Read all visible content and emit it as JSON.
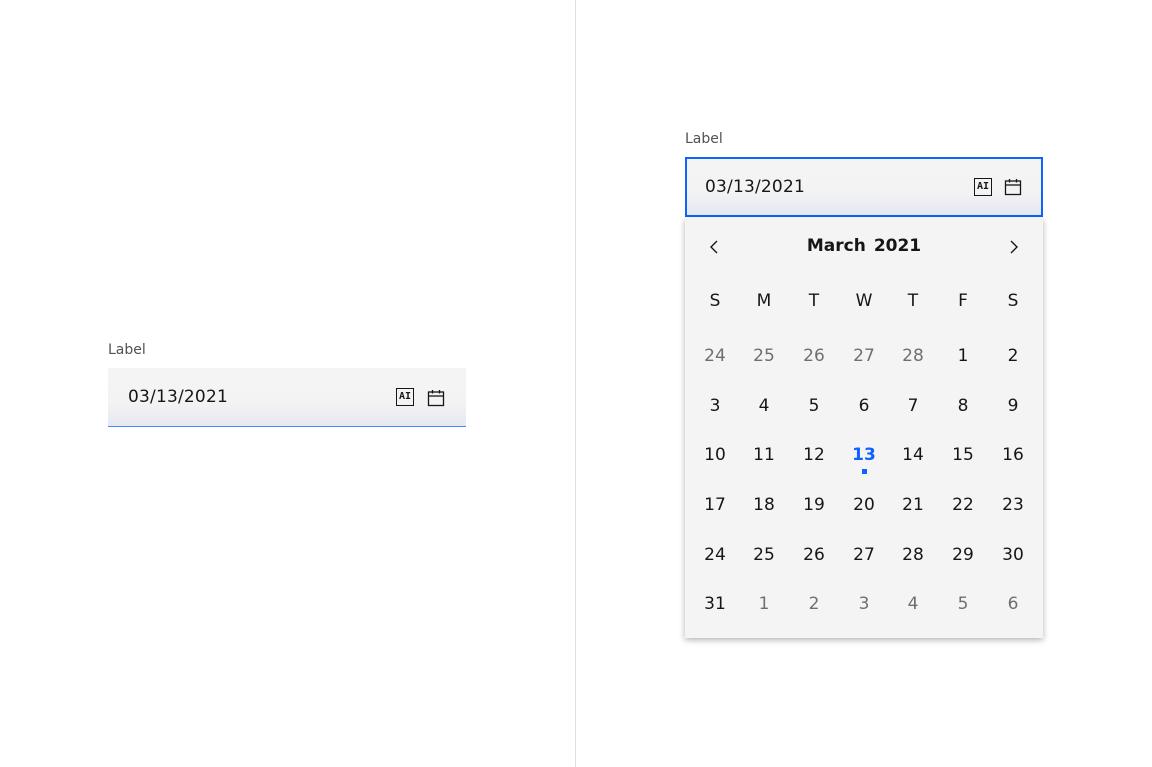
{
  "left_picker": {
    "label": "Label",
    "value": "03/13/2021",
    "ai_label": "AI"
  },
  "right_picker": {
    "label": "Label",
    "value": "03/13/2021",
    "ai_label": "AI"
  },
  "calendar": {
    "month": "March",
    "year": "2021",
    "weekdays": [
      "S",
      "M",
      "T",
      "W",
      "T",
      "F",
      "S"
    ],
    "weeks": [
      [
        "24",
        "25",
        "26",
        "27",
        "28",
        "1",
        "2"
      ],
      [
        "3",
        "4",
        "5",
        "6",
        "7",
        "8",
        "9"
      ],
      [
        "10",
        "11",
        "12",
        "13",
        "14",
        "15",
        "16"
      ],
      [
        "17",
        "18",
        "19",
        "20",
        "21",
        "22",
        "23"
      ],
      [
        "24",
        "25",
        "26",
        "27",
        "28",
        "29",
        "30"
      ],
      [
        "31",
        "1",
        "2",
        "3",
        "4",
        "5",
        "6"
      ]
    ],
    "selected_day": "13",
    "accent_color": "#0f62fe"
  }
}
